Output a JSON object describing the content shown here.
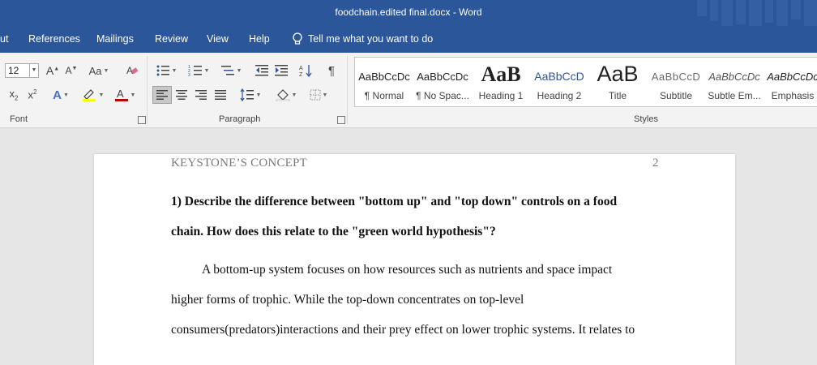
{
  "window": {
    "title": "foodchain.edited final.docx  -  Word"
  },
  "tabs": [
    "ut",
    "References",
    "Mailings",
    "Review",
    "View",
    "Help"
  ],
  "tell_me": "Tell me what you want to do",
  "font_group": {
    "size": "12",
    "label": "Font"
  },
  "paragraph_group": {
    "label": "Paragraph"
  },
  "styles_group": {
    "label": "Styles",
    "items": [
      {
        "sample": "AaBbCcDc",
        "name": "¶ Normal"
      },
      {
        "sample": "AaBbCcDc",
        "name": "¶ No Spac..."
      },
      {
        "sample": "AaB",
        "name": "Heading 1"
      },
      {
        "sample": "AaBbCcD",
        "name": "Heading 2"
      },
      {
        "sample": "AaB",
        "name": "Title"
      },
      {
        "sample": "AaBbCcD",
        "name": "Subtitle"
      },
      {
        "sample": "AaBbCcDc",
        "name": "Subtle Em..."
      },
      {
        "sample": "AaBbCcDc",
        "name": "Emphasis"
      }
    ]
  },
  "document": {
    "header": "KEYSTONE’S CONCEPT",
    "page_number": "2",
    "question_line1": "1) Describe the difference between \"bottom up\" and \"top down\" controls on a food",
    "question_line2": "chain. How does this relate to the \"green world hypothesis\"?",
    "body_line1": "A bottom-up system focuses on how resources such as nutrients and space impact",
    "body_line2": "higher forms of trophic. While the top-down concentrates on top-level",
    "body_line3": "consumers(predators)interactions and their prey effect on lower trophic systems. It relates to"
  },
  "colors": {
    "accent": "#2b579a",
    "highlight": "#ffff00",
    "font_color": "#c00000"
  }
}
